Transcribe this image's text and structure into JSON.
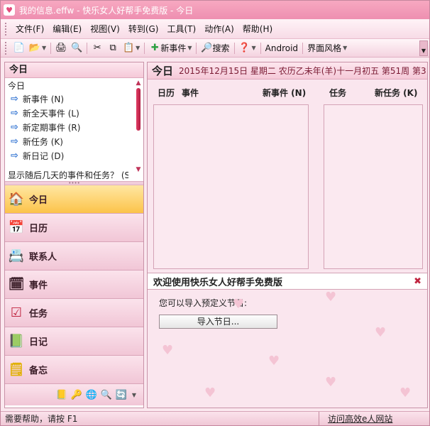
{
  "window": {
    "title": "我的信息.effw - 快乐女人好帮手免费版 - 今日"
  },
  "menu": [
    "文件(F)",
    "编辑(E)",
    "视图(V)",
    "转到(G)",
    "工具(T)",
    "动作(A)",
    "帮助(H)"
  ],
  "toolbar": {
    "new_event": "新事件",
    "search": "搜索",
    "android": "Android",
    "skin": "界面风格"
  },
  "left": {
    "header": "今日",
    "sub": "今日",
    "links": [
      "新事件 (N)",
      "新全天事件 (L)",
      "新定期事件 (R)",
      "新任务 (K)",
      "新日记 (D)"
    ],
    "more": "显示随后几天的事件和任务？ (S)",
    "nav": [
      "今日",
      "日历",
      "联系人",
      "事件",
      "任务",
      "日记",
      "备忘"
    ]
  },
  "right": {
    "title": "今日",
    "date": "2015年12月15日  星期二  农历乙未年(羊)十一月初五  第51周  第3",
    "cols": {
      "calendar": "日历",
      "event": "事件",
      "new_event": "新事件 (N)",
      "task": "任务",
      "new_task": "新任务 (K)"
    },
    "welcome": "欢迎使用快乐女人好帮手免费版",
    "import_text": "您可以导入预定义节日:",
    "import_btn": "导入节日..."
  },
  "status": {
    "help": "需要帮助，请按 F1",
    "link": "访问高效e人网站"
  },
  "colors": {
    "accent": "#ee8fb0",
    "active_nav": "#fcc34a",
    "link_arrow": "#2b6fd1"
  }
}
